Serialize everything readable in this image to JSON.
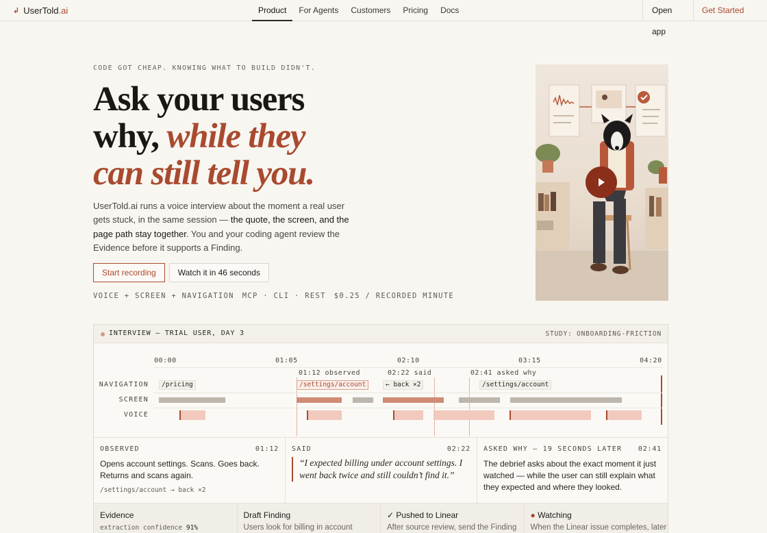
{
  "nav": {
    "logo_main": "UserTold",
    "logo_accent": ".ai",
    "links": [
      "Product",
      "For Agents",
      "Customers",
      "Pricing",
      "Docs"
    ],
    "open_app": "Open app",
    "get_started": "Get Started"
  },
  "hero": {
    "eyebrow": "CODE GOT CHEAP. KNOWING WHAT TO BUILD DIDN'T.",
    "headline_1": "Ask your users",
    "headline_2": "why,",
    "headline_3": "while they",
    "headline_4": "can still tell you.",
    "body_1": "UserTold.ai runs a voice interview about the moment a real user gets stuck, in the same session — ",
    "body_strong": "the quote, the screen, and the page path stay together",
    "body_2": ". You and your coding agent review the Evidence before it supports a Finding.",
    "cta_record": "Start recording",
    "cta_watch": "Watch it in 46 seconds",
    "meta": [
      "VOICE + SCREEN + NAVIGATION",
      "MCP · CLI · REST",
      "$0.25 / RECORDED MINUTE"
    ]
  },
  "panel": {
    "title": "INTERVIEW — TRIAL USER, DAY 3",
    "study": "STUDY: ONBOARDING-FRICTION",
    "ticks": [
      "00:00",
      "01:05",
      "02:10",
      "03:15",
      "04:20"
    ],
    "events": [
      "01:12 observed",
      "02:22 said",
      "02:41 asked why"
    ],
    "rows": [
      "NAVIGATION",
      "SCREEN",
      "VOICE"
    ],
    "nav_chips": [
      "/pricing",
      "/settings/account",
      "← back ×2",
      "/settings/account"
    ],
    "cards": [
      {
        "heading": "OBSERVED",
        "time": "01:12",
        "body": "Opens account settings. Scans. Goes back. Returns and scans again.",
        "sub": "/settings/account → back ×2"
      },
      {
        "heading": "SAID",
        "time": "02:22",
        "quote": "“I expected billing under account settings. I went back twice and still couldn’t find it.”"
      },
      {
        "heading": "ASKED WHY — 19 SECONDS LATER",
        "time": "02:41",
        "body": "The debrief asks about the exact moment it just watched — while the user can still explain what they expected and where they looked."
      }
    ],
    "steps": [
      {
        "heading": "Evidence",
        "body_prefix": "extraction confidence ",
        "body_value": "91%"
      },
      {
        "heading": "Draft Finding",
        "body": "Users look for billing in account"
      },
      {
        "heading": "✓ Pushed to Linear",
        "body": "After source review, send the Finding"
      },
      {
        "heading": "Watching",
        "bullet": "●",
        "body": "When the Linear issue completes, later"
      }
    ]
  },
  "colors": {
    "accent": "#a94a2f",
    "background": "#f8f6f1"
  }
}
